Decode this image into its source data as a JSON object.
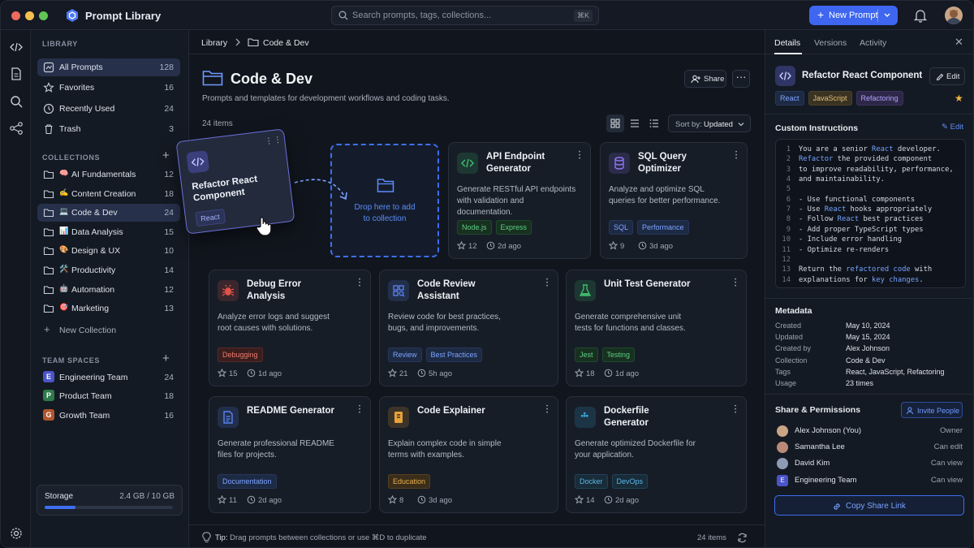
{
  "app": {
    "title": "Prompt Library"
  },
  "search": {
    "placeholder": "Search prompts, tags, collections...",
    "shortcut": "⌘K"
  },
  "header": {
    "new_button": "New Prompt"
  },
  "sidebar": {
    "library_title": "LIBRARY",
    "library_items": [
      {
        "label": "All Prompts",
        "count": "128",
        "icon": "grid-icon"
      },
      {
        "label": "Favorites",
        "count": "16",
        "icon": "star-icon"
      },
      {
        "label": "Recently Used",
        "count": "24",
        "icon": "clock-icon"
      },
      {
        "label": "Trash",
        "count": "3",
        "icon": "trash-icon"
      }
    ],
    "collections_title": "COLLECTIONS",
    "collections": [
      {
        "emoji": "🧠",
        "label": "AI Fundamentals",
        "count": "12"
      },
      {
        "emoji": "✍️",
        "label": "Content Creation",
        "count": "18"
      },
      {
        "emoji": "💻",
        "label": "Code & Dev",
        "count": "24"
      },
      {
        "emoji": "📊",
        "label": "Data Analysis",
        "count": "15"
      },
      {
        "emoji": "🎨",
        "label": "Design & UX",
        "count": "10"
      },
      {
        "emoji": "🛠️",
        "label": "Productivity",
        "count": "14"
      },
      {
        "emoji": "🤖",
        "label": "Automation",
        "count": "12"
      },
      {
        "emoji": "🎯",
        "label": "Marketing",
        "count": "13"
      }
    ],
    "new_collection": "New Collection",
    "team_title": "TEAM SPACES",
    "teams": [
      {
        "badge": "E",
        "label": "Engineering Team",
        "count": "24",
        "color": "#4a55c9"
      },
      {
        "badge": "P",
        "label": "Product Team",
        "count": "18",
        "color": "#2f7a4a"
      },
      {
        "badge": "G",
        "label": "Growth Team",
        "count": "16",
        "color": "#b0562e"
      }
    ],
    "storage": {
      "label": "Storage",
      "value": "2.4 GB / 10 GB",
      "fraction": 0.24
    }
  },
  "main": {
    "breadcrumb": {
      "root": "Library",
      "current": "Code & Dev"
    },
    "title": "Code & Dev",
    "description": "Prompts and templates for development workflows and coding tasks.",
    "share": "Share",
    "items_count": "24 items",
    "sort_label": "Sort by:",
    "sort_value": "Updated",
    "drop_text_1": "Drop here to add",
    "drop_text_2": "to collection",
    "dragging": {
      "title": "Refactor React Component",
      "tag": "React"
    },
    "cards": [
      {
        "title": "API Endpoint Generator",
        "desc": "Generate RESTful API endpoints with validation and documentation.",
        "tags": [
          "Node.js",
          "Express"
        ],
        "stars": "12",
        "time": "2d ago",
        "icon": "code-icon",
        "accent": "#3fb86a"
      },
      {
        "title": "SQL Query Optimizer",
        "desc": "Analyze and optimize SQL queries for better performance.",
        "tags": [
          "SQL",
          "Performance"
        ],
        "stars": "9",
        "time": "3d ago",
        "icon": "database-icon",
        "accent": "#8c76f0"
      },
      {
        "title": "Debug Error Analysis",
        "desc": "Analyze error logs and suggest root causes with solutions.",
        "tags": [
          "Debugging"
        ],
        "stars": "15",
        "time": "1d ago",
        "icon": "bug-icon",
        "accent": "#e0534a"
      },
      {
        "title": "Code Review Assistant",
        "desc": "Review code for best practices, bugs, and improvements.",
        "tags": [
          "Review",
          "Best Practices"
        ],
        "stars": "21",
        "time": "5h ago",
        "icon": "review-icon",
        "accent": "#5b84f2"
      },
      {
        "title": "Unit Test Generator",
        "desc": "Generate comprehensive unit tests for functions and classes.",
        "tags": [
          "Jest",
          "Testing"
        ],
        "stars": "18",
        "time": "1d ago",
        "icon": "flask-icon",
        "accent": "#3fb86a"
      },
      {
        "title": "README Generator",
        "desc": "Generate professional README files for projects.",
        "tags": [
          "Documentation"
        ],
        "stars": "11",
        "time": "2d ago",
        "icon": "document-icon",
        "accent": "#5b84f2"
      },
      {
        "title": "Code Explainer",
        "desc": "Explain complex code in simple terms with examples.",
        "tags": [
          "Education"
        ],
        "stars": "8",
        "time": "3d ago",
        "icon": "book-icon",
        "accent": "#e8a13a"
      },
      {
        "title": "Dockerfile Generator",
        "desc": "Generate optimized Dockerfile for your application.",
        "tags": [
          "Docker",
          "DevOps"
        ],
        "stars": "14",
        "time": "2d ago",
        "icon": "docker-icon",
        "accent": "#3aa6d8"
      }
    ],
    "tip_prefix": "Tip:",
    "tip_text": "Drag prompts between collections or use ⌘D to duplicate",
    "footer_count": "24 items"
  },
  "panel": {
    "tabs": [
      "Details",
      "Versions",
      "Activity"
    ],
    "title": "Refactor React Component",
    "edit": "Edit",
    "tags": [
      "React",
      "JavaScript",
      "Refactoring"
    ],
    "instructions_title": "Custom Instructions",
    "instructions_edit": "Edit",
    "code_lines": [
      "You are a senior React developer.",
      "Refactor the provided component",
      "to improve readability, performance,",
      "and maintainability.",
      "",
      "- Use functional components",
      "- Use React hooks appropriately",
      "- Follow React best practices",
      "- Add proper TypeScript types",
      "- Include error handling",
      "- Optimize re-renders",
      "",
      "Return the refactored code with",
      "explanations for key changes."
    ],
    "metadata_title": "Metadata",
    "metadata": [
      {
        "k": "Created",
        "v": "May 10, 2024"
      },
      {
        "k": "Updated",
        "v": "May 15, 2024"
      },
      {
        "k": "Created by",
        "v": "Alex Johnson"
      },
      {
        "k": "Collection",
        "v": "Code & Dev"
      },
      {
        "k": "Tags",
        "v": "React, JavaScript, Refactoring"
      },
      {
        "k": "Usage",
        "v": "23 times"
      }
    ],
    "share_title": "Share & Permissions",
    "invite": "Invite People",
    "people": [
      {
        "name": "Alex Johnson (You)",
        "role": "Owner",
        "color": "#c9a585"
      },
      {
        "name": "Samantha Lee",
        "role": "Can edit",
        "color": "#b98a78"
      },
      {
        "name": "David Kim",
        "role": "Can view",
        "color": "#8e9bb5"
      },
      {
        "name": "Engineering Team",
        "role": "Can view",
        "color": "#4a55c9",
        "badge": "E"
      }
    ],
    "copy_link": "Copy Share Link"
  }
}
